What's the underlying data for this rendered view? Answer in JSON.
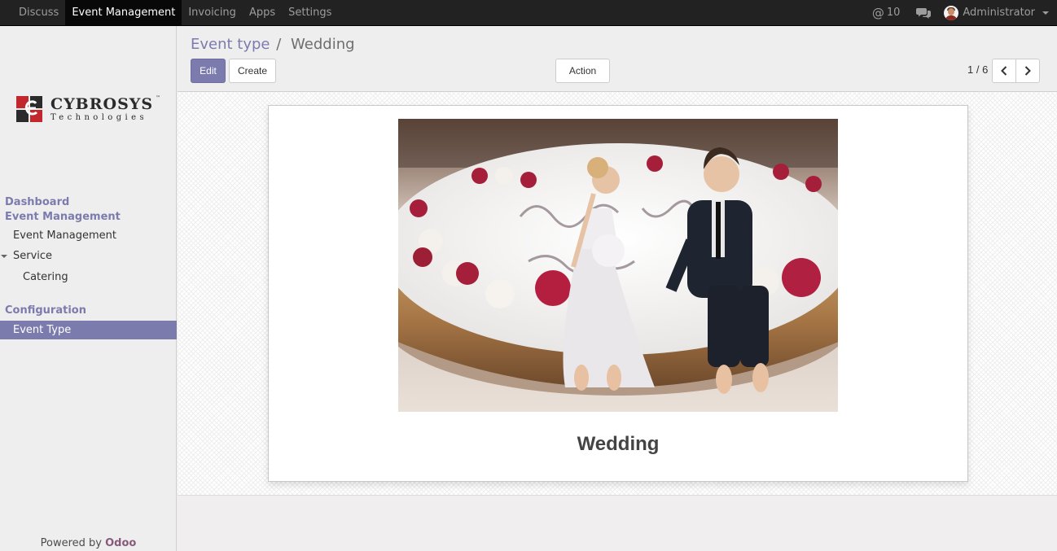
{
  "topbar": {
    "menu": [
      {
        "label": "Discuss",
        "active": false
      },
      {
        "label": "Event Management",
        "active": true
      },
      {
        "label": "Invoicing",
        "active": false
      },
      {
        "label": "Apps",
        "active": false
      },
      {
        "label": "Settings",
        "active": false
      }
    ],
    "notification_count": "10",
    "notification_icon": "at-icon",
    "chat_icon": "chat-bubbles-icon",
    "user_name": "Administrator"
  },
  "sidebar": {
    "logo": {
      "brand": "CYBROSYS",
      "tm": "™",
      "tagline": "Technologies"
    },
    "sections": {
      "dashboard": "Dashboard",
      "event_management": "Event Management",
      "event_management_item": "Event Management",
      "service": "Service",
      "catering": "Catering",
      "configuration": "Configuration",
      "event_type": "Event Type"
    },
    "powered_prefix": "Powered by ",
    "powered_brand": "Odoo"
  },
  "control_panel": {
    "breadcrumb_parent": "Event type",
    "breadcrumb_separator": "/",
    "breadcrumb_current": "Wedding",
    "edit_label": "Edit",
    "create_label": "Create",
    "action_label": "Action",
    "pager": "1 / 6"
  },
  "form": {
    "image_description_icon": "wedding-cake-photo",
    "name": "Wedding"
  },
  "colors": {
    "accent": "#7c7bad",
    "navbar": "#222222",
    "odoo": "#875a7b"
  }
}
